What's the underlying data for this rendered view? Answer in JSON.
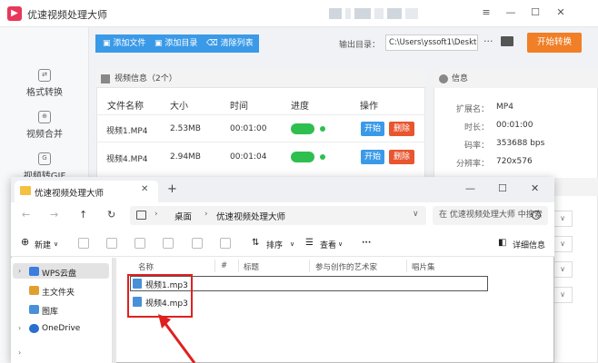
{
  "app": {
    "title": "优速视频处理大师",
    "window_controls": [
      "≡",
      "—",
      "☐",
      "✕"
    ]
  },
  "sidebar": {
    "items": [
      {
        "label": "格式转换",
        "icon": "convert-icon"
      },
      {
        "label": "视频合并",
        "icon": "merge-icon"
      },
      {
        "label": "视频转GIF",
        "icon": "gif-icon"
      }
    ]
  },
  "toolbar": {
    "add_file": "添加文件",
    "add_dir": "添加目录",
    "clear_list": "清除列表",
    "output_label": "输出目录：",
    "output_path": "C:\\Users\\yssoft1\\Deskt",
    "dots": "···",
    "start_convert": "开始转换"
  },
  "video_panel": {
    "header": "视频信息（2个）",
    "columns": [
      "文件名称",
      "大小",
      "时间",
      "进度",
      "操作"
    ],
    "rows": [
      {
        "name": "视频1.MP4",
        "size": "2.53MB",
        "time": "00:01:00",
        "start": "开始",
        "delete": "删除"
      },
      {
        "name": "视频4.MP4",
        "size": "2.94MB",
        "time": "00:01:04",
        "start": "开始",
        "delete": "删除"
      }
    ]
  },
  "info_panel": {
    "header": "信息",
    "fields": [
      {
        "key": "扩展名：",
        "value": "MP4"
      },
      {
        "key": "时长：",
        "value": "00:01:00"
      },
      {
        "key": "码率：",
        "value": "353688 bps"
      },
      {
        "key": "分辨率：",
        "value": "720x576"
      }
    ]
  },
  "explorer": {
    "tab_title": "优速视频处理大师",
    "tab_close": "✕",
    "tab_add": "+",
    "window_controls": [
      "—",
      "☐",
      "✕"
    ],
    "breadcrumb": [
      "桌面",
      "优速视频处理大师"
    ],
    "search_placeholder": "在 优速视频处理大师 中搜索",
    "commands": {
      "new": "新建",
      "sort": "排序",
      "view": "查看",
      "more": "···",
      "details": "详细信息"
    },
    "nav_items": [
      {
        "label": "WPS云盘",
        "color": "#3b7de0"
      },
      {
        "label": "主文件夹",
        "color": "#e0a030"
      },
      {
        "label": "图库",
        "color": "#4a90d9"
      },
      {
        "label": "OneDrive",
        "color": "#2a6fd0"
      }
    ],
    "columns": [
      "名称",
      "#",
      "标题",
      "参与创作的艺术家",
      "唱片集"
    ],
    "files": [
      "视频1.mp3",
      "视频4.mp3"
    ]
  }
}
